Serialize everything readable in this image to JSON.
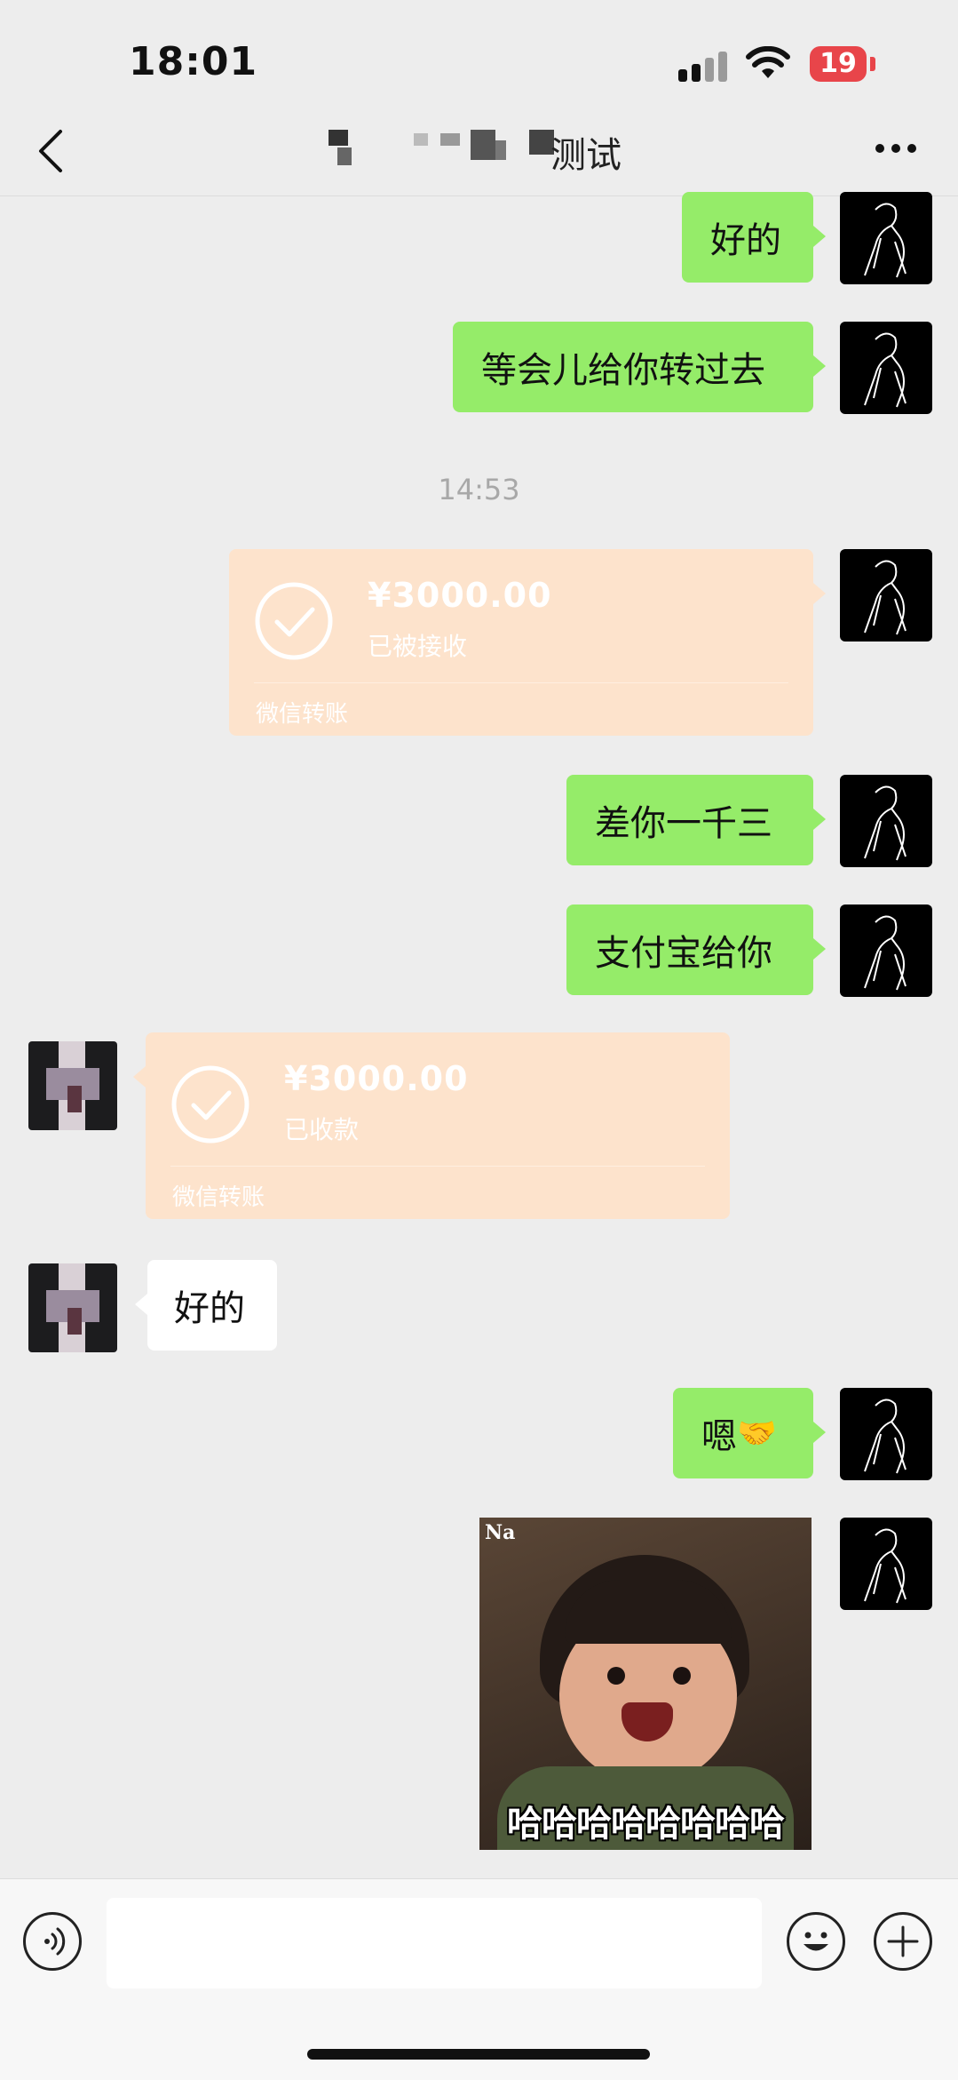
{
  "status_bar": {
    "time": "18:01",
    "battery": "19"
  },
  "header": {
    "title_suffix": "测试"
  },
  "messages": [
    {
      "text": "好的"
    },
    {
      "text": "等会儿给你转过去"
    },
    {
      "time": "14:53"
    },
    {
      "amount": "¥3000.00",
      "status": "已被接收",
      "source": "微信转账"
    },
    {
      "text": "差你一千三"
    },
    {
      "text": "支付宝给你"
    },
    {
      "amount": "¥3000.00",
      "status": "已收款",
      "source": "微信转账"
    },
    {
      "text": "好的"
    },
    {
      "text": "嗯",
      "emoji": "🤝"
    },
    {
      "sticker_tag": "Na",
      "sticker_caption": "哈哈哈哈哈哈哈哈"
    }
  ],
  "input_bar": {
    "placeholder": ""
  },
  "colors": {
    "outgoing_bubble": "#95ec69",
    "incoming_bubble": "#ffffff",
    "transfer_card": "#fde3cc",
    "battery": "#e8454a"
  }
}
